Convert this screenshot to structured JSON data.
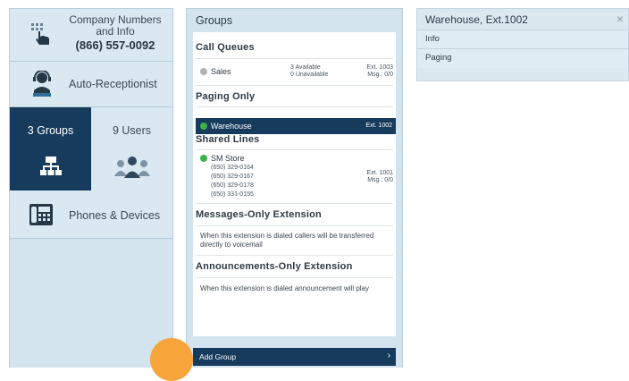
{
  "nav": {
    "company_line1": "Company Numbers",
    "company_line2": "and Info",
    "company_phone": "(866) 557-0092",
    "auto_receptionist": "Auto-Receptionist",
    "groups_tab": "3 Groups",
    "users_tab": "9 Users",
    "phones_devices": "Phones & Devices"
  },
  "groups": {
    "title": "Groups",
    "call_queues_heading": "Call Queues",
    "sales": {
      "name": "Sales",
      "available": "3 Available",
      "unavailable": "0 Unavailable",
      "ext": "Ext. 1003",
      "msg": "Msg.: 0/0"
    },
    "paging_heading": "Paging Only",
    "warehouse": {
      "name": "Warehouse",
      "ext": "Ext. 1002"
    },
    "shared_heading": "Shared Lines",
    "sm_store": {
      "name": "SM Store",
      "phones": [
        "(650) 329-0164",
        "(650) 329-0167",
        "(650) 329-0178",
        "(650) 331-0155"
      ],
      "ext": "Ext. 1001",
      "msg": "Msg.: 0/0"
    },
    "messages_heading": "Messages-Only Extension",
    "messages_desc": "When this extension is dialed callers will be transferred directly to voicemail",
    "announcements_heading": "Announcements-Only Extension",
    "announcements_desc": "When this extension is dialed announcement will play",
    "add_group": "Add Group",
    "add_chevron": "›"
  },
  "detail": {
    "title": "Warehouse, Ext.1002",
    "close": "×",
    "rows": [
      "Info",
      "Paging"
    ]
  },
  "colors": {
    "navy": "#163b5c",
    "panel": "#d3e4ee",
    "highlight": "#f7a53a",
    "online": "#3db24a"
  },
  "icons": [
    "touch-hand-icon",
    "receptionist-icon",
    "org-chart-icon",
    "users-group-icon",
    "desk-phone-icon",
    "status-dot-icon",
    "close-icon",
    "chevron-right-icon"
  ]
}
